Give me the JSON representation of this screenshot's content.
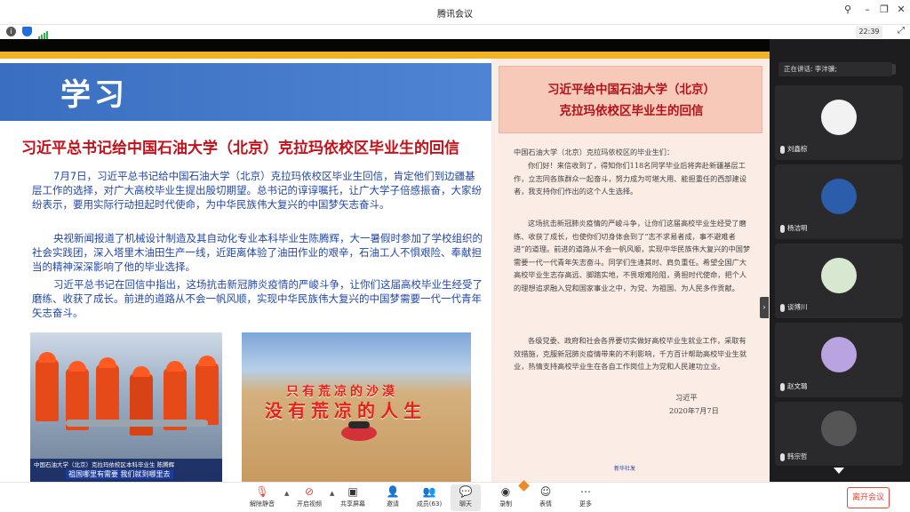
{
  "window": {
    "title": "腾讯会议"
  },
  "status": {
    "clock": "22:39"
  },
  "slide": {
    "banner_word": "学习",
    "headline": "习近平总书记给中国石油大学（北京）克拉玛依校区毕业生的回信",
    "paragraphs": [
      "7月7日，习近平总书记给中国石油大学（北京）克拉玛依校区毕业生回信，肯定他们到边疆基层工作的选择，对广大高校毕业生提出殷切期望。总书记的谆谆嘱托，让广大学子倍感振奋，大家纷纷表示，要用实际行动担起时代使命，为中华民族伟大复兴的中国梦矢志奋斗。",
      "央视新闻报道了机械设计制造及其自动化专业本科毕业生陈腾辉，大一暑假时参加了学校组织的社会实践团，深入塔里木油田生产一线，近距离体验了油田作业的艰辛，石油工人不惧艰险、奉献担当的精神深深影响了他的毕业选择。",
      "习近平总书记在回信中指出，这场抗击新冠肺炎疫情的严峻斗争，让你们这届高校毕业生经受了磨练、收获了成长。前进的道路从不会一帆风顺，实现中华民族伟大复兴的中国梦需要一代一代青年矢志奋斗。"
    ],
    "photo1": {
      "caption_line1": "中国石油大学（北京）克拉玛依校区本科毕业生 陈腾辉",
      "caption_line2": "祖国哪里有需要  我们就到哪里去"
    },
    "photo2": {
      "sign_top": "只有荒凉的沙漠",
      "sign_main": "没有荒凉的人生"
    },
    "letter": {
      "title_line1": "习近平给中国石油大学（北京）",
      "title_line2": "克拉玛依校区毕业生的回信",
      "greeting": "中国石油大学（北京）克拉玛依校区的毕业生们：",
      "body": [
        "你们好！来信收到了，得知你们118名同学毕业后将奔赴新疆基层工作，立志同各族群众一起奋斗，努力成为可堪大用、能担重任的西部建设者，我支持你们作出的这个人生选择。",
        "这场抗击新冠肺炎疫情的严峻斗争，让你们这届高校毕业生经受了磨练、收获了成长，也使你们切身体会到了“志不求易者成，事不避难者进”的道理。前进的道路从不会一帆风顺，实现中华民族伟大复兴的中国梦需要一代一代青年矢志奋斗。同学们生逢其时、肩负重任。希望全国广大高校毕业生志存高远、脚踏实地，不畏艰难险阻，勇担时代使命，把个人的理想追求融入党和国家事业之中，为党、为祖国、为人民多作贡献。",
        "各级党委、政府和社会各界要切实做好高校毕业生就业工作，采取有效措施，克服新冠肺炎疫情带来的不利影响，千方百计帮助高校毕业生就业，热情支持高校毕业生在各自工作岗位上为党和人民建功立业。"
      ],
      "signature": "习近平",
      "date": "2020年7月7日",
      "source_mark": "新华社发"
    }
  },
  "panel": {
    "speaking": "正在讲话: 李沣骥;",
    "participants": [
      {
        "name": "刘鑫棕",
        "color": "#f2f2f2"
      },
      {
        "name": "杨洁明",
        "color": "#2b5dab"
      },
      {
        "name": "谈博川",
        "color": "#d8e8d0"
      },
      {
        "name": "赵文璐",
        "color": "#b9a3e0"
      },
      {
        "name": "韩宗哲",
        "color": "#555555"
      }
    ]
  },
  "toolbar": {
    "unmute": "解除静音",
    "video": "开启视频",
    "share": "共享屏幕",
    "invite": "邀请",
    "members": "成员(63)",
    "chat": "聊天",
    "record": "录制",
    "reactions": "表情",
    "more": "更多",
    "leave": "离开会议"
  }
}
